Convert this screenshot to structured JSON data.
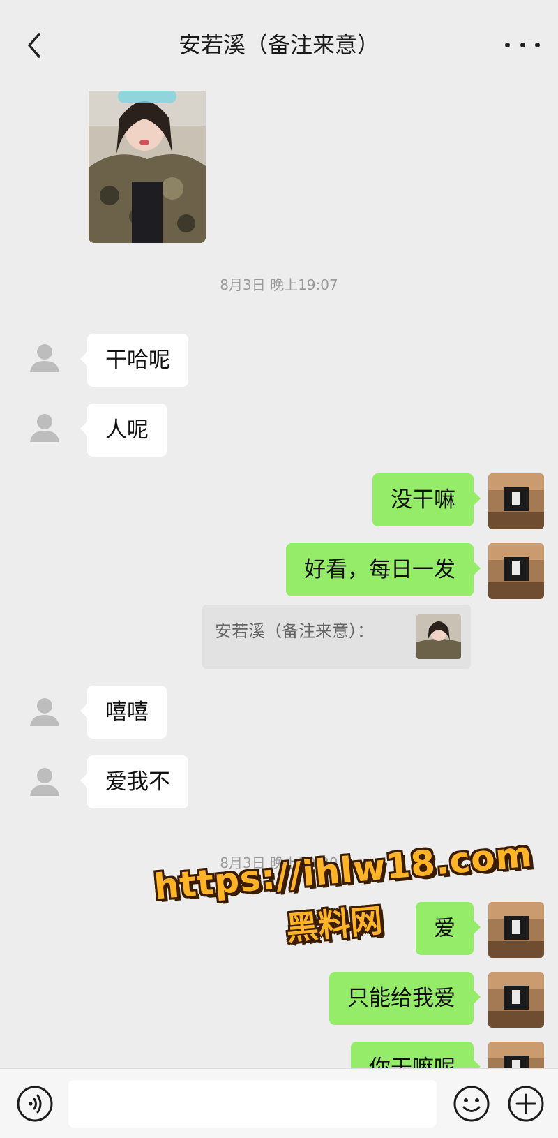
{
  "header": {
    "title": "安若溪（备注来意）",
    "back_icon": "chevron-left-icon",
    "more_icon": "more-dots-icon"
  },
  "timestamps": [
    "8月3日 晚上19:07",
    "8月3日 晚上19:20"
  ],
  "messages_in_1": [
    "干哈呢",
    "人呢"
  ],
  "messages_out_1": [
    "没干嘛",
    "好看，每日一发"
  ],
  "quote": {
    "text": "安若溪（备注来意）："
  },
  "messages_in_2": [
    "嘻嘻",
    "爱我不"
  ],
  "messages_out_2": [
    "爱",
    "只能给我爱",
    "你干嘛呢"
  ],
  "watermark": {
    "line1": "https://ihlw18.com",
    "line2": "黑料网"
  },
  "input_bar": {
    "voice_icon": "voice-icon",
    "emoji_icon": "emoji-icon",
    "plus_icon": "plus-icon"
  },
  "colors": {
    "background": "#ededed",
    "outgoing_bubble": "#95ec69",
    "incoming_bubble": "#ffffff",
    "watermark": "#ffb428"
  }
}
